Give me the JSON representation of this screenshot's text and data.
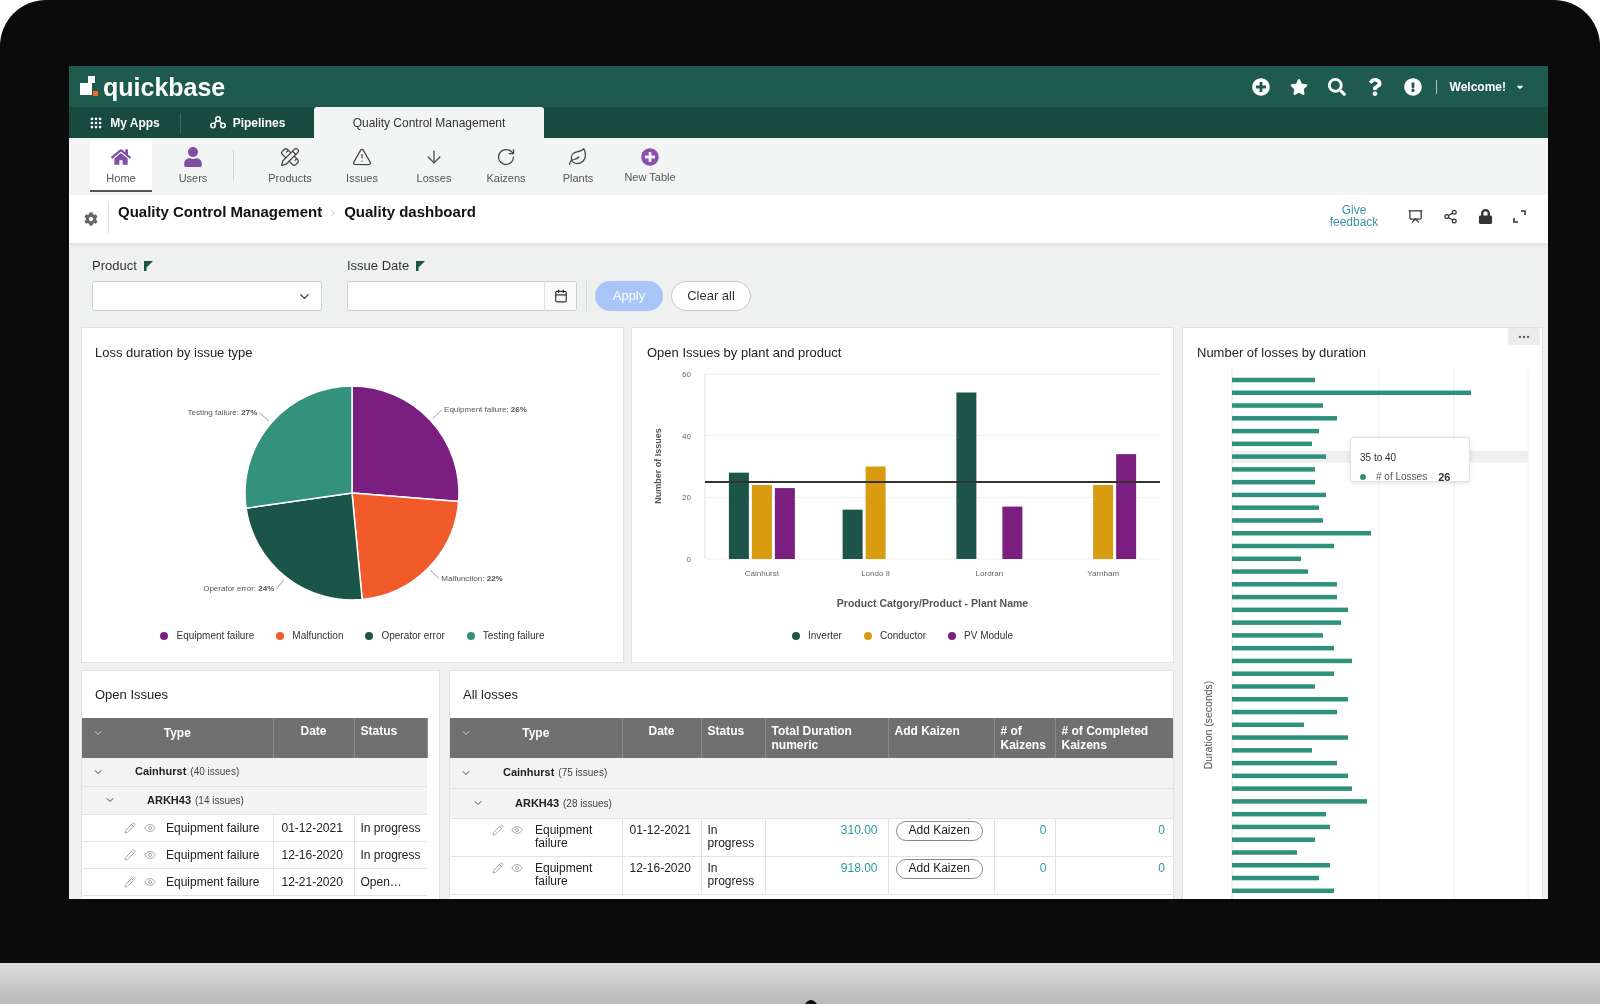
{
  "header": {
    "logo": "quickbase",
    "welcome": "Welcome!"
  },
  "tabs": [
    {
      "label": "My Apps",
      "kind": "apps",
      "selected": false
    },
    {
      "label": "Pipelines",
      "kind": "pipelines",
      "selected": false
    },
    {
      "label": "Quality Control Management",
      "kind": "app",
      "selected": true
    }
  ],
  "toolbar": {
    "pinned": [
      {
        "label": "Home",
        "kind": "home",
        "selected": true
      },
      {
        "label": "Users",
        "kind": "users",
        "selected": false
      }
    ],
    "tables": [
      {
        "label": "Products",
        "kind": "products",
        "selected": false
      },
      {
        "label": "Issues",
        "kind": "issues",
        "selected": false
      },
      {
        "label": "Losses",
        "kind": "losses",
        "selected": false
      },
      {
        "label": "Kaizens",
        "kind": "kaizens",
        "selected": false
      },
      {
        "label": "Plants",
        "kind": "plants",
        "selected": false
      },
      {
        "label": "New Table",
        "kind": "new",
        "selected": false
      }
    ]
  },
  "breadcrumb": {
    "app": "Quality Control Management",
    "page": "Quality dashboard",
    "feedback": "Give feedback"
  },
  "filters": {
    "fields": [
      {
        "label": "Product",
        "kind": "select"
      },
      {
        "label": "Issue Date",
        "kind": "date"
      }
    ],
    "buttons": [
      {
        "label": "Apply",
        "kind": "primary",
        "disabled": true
      },
      {
        "label": "Clear all",
        "kind": "secondary",
        "disabled": false
      }
    ]
  },
  "loss_duration_card": {
    "chart_data": {
      "type": "pie",
      "title": "Loss duration by issue type",
      "categories": [
        "Equipment failure",
        "Malfunction",
        "Operator error",
        "Testing failure"
      ],
      "values": [
        26,
        22,
        24,
        27
      ],
      "colors": [
        "#7a1f80",
        "#f15a2b",
        "#1b5449",
        "#33917e"
      ],
      "value_labels": [
        "Equipment failure: **26%**",
        "Malfunction: **22%**",
        "Operator error: **24%**",
        "Testing failure: **27%**"
      ],
      "legend": "bottom"
    }
  },
  "open_issues_chart": {
    "chart_data": {
      "type": "bar",
      "title": "Open Issues by plant and product",
      "xlabel": "Product Catgory/Product - Plant Name",
      "ylabel": "Number of Issues",
      "categories": [
        "Cainhurst",
        "Londo II",
        "Lordran",
        "Yarnham"
      ],
      "series": [
        {
          "name": "Inverter",
          "color": "#1c5449",
          "values": [
            28,
            16,
            54,
            null
          ]
        },
        {
          "name": "Conductor",
          "color": "#d99b10",
          "values": [
            24,
            30,
            null,
            24
          ]
        },
        {
          "name": "PV Module",
          "color": "#7a1f80",
          "values": [
            23,
            null,
            17,
            34
          ]
        }
      ],
      "ylim": [
        0,
        60
      ],
      "yticks": [
        0,
        20,
        40,
        60
      ],
      "ref_lines": [
        {
          "axis": "y",
          "value": 25
        }
      ],
      "legend": "bottom"
    }
  },
  "losses_chart": {
    "title": "Number of losses by duration",
    "ylabel": "Duration (seconds)",
    "tooltip": {
      "range": "35 to 40",
      "series": "# of Losses",
      "value": "26"
    }
  },
  "open_issues": {
    "title": "Open Issues",
    "columns": [
      "Type",
      "Date",
      "Status"
    ],
    "groups": [
      {
        "label": "Cainhurst",
        "count": "(40 issues)",
        "expanded": true,
        "children": [
          {
            "label": "ARKH43",
            "count": "(14 issues)",
            "expanded": true,
            "rows": [
              {
                "type": "Equipment failure",
                "date": "01-12-2021",
                "status": "In progress"
              },
              {
                "type": "Equipment failure",
                "date": "12-16-2020",
                "status": "In progress"
              },
              {
                "type": "Equipment failure",
                "date": "12-21-2020",
                "status": "Open…"
              }
            ]
          }
        ]
      }
    ]
  },
  "all_losses": {
    "title": "All losses",
    "columns": [
      "Type",
      "Date",
      "Status",
      "Total Duration numeric",
      "Add Kaizen",
      "# of Kaizens",
      "# of Completed Kaizens"
    ],
    "groups": [
      {
        "label": "Cainhurst",
        "count": "(75 issues)",
        "expanded": true,
        "children": [
          {
            "label": "ARKH43",
            "count": "(28 issues)",
            "expanded": true,
            "rows": [
              {
                "type": "Equipment failure",
                "date": "01-12-2021",
                "status": "In progress",
                "duration": "310.00",
                "action": "Add Kaizen",
                "kaizens": "0",
                "completed": "0"
              },
              {
                "type": "Equipment failure",
                "date": "12-16-2020",
                "status": "In progress",
                "duration": "918.00",
                "action": "Add Kaizen",
                "kaizens": "0",
                "completed": "0"
              }
            ]
          }
        ]
      }
    ]
  }
}
